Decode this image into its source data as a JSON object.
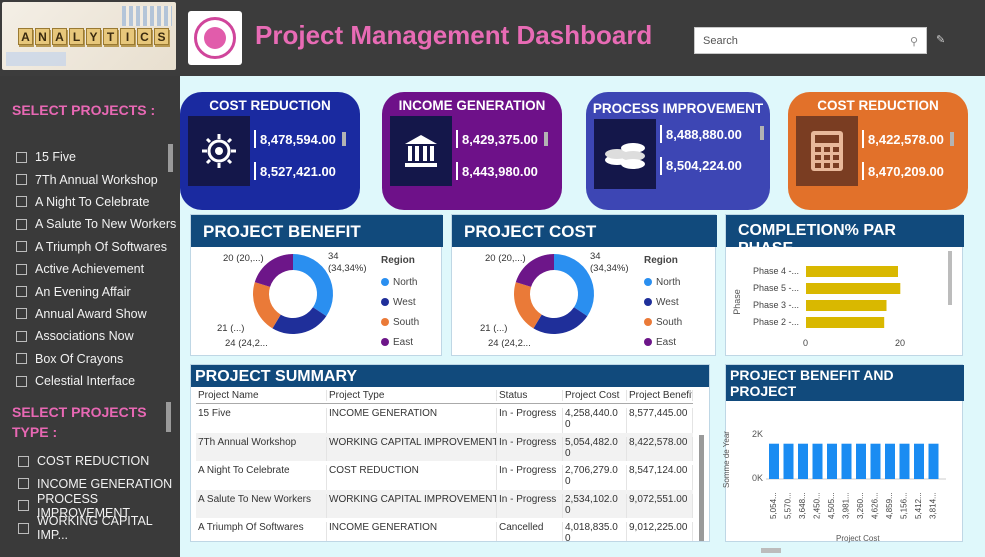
{
  "header": {
    "logo_text": "ANALYTICS",
    "title": "Project Management Dashboard",
    "search_placeholder": "Search"
  },
  "sidebar": {
    "projects_title": "SELECT PROJECTS :",
    "projects": [
      "15 Five",
      "7Th Annual Workshop",
      "A Night To Celebrate",
      "A Salute To New Workers",
      "A Triumph Of Softwares",
      "Active Achievement",
      "An Evening Affair",
      "Annual Award Show",
      "Associations Now",
      "Box Of Crayons",
      "Celestial Interface"
    ],
    "types_title_1": "SELECT PROJECTS",
    "types_title_2": "TYPE :",
    "types": [
      "COST REDUCTION",
      "INCOME GENERATION",
      "PROCESS IMPROVEMENT",
      "WORKING CAPITAL IMP..."
    ]
  },
  "kpis": [
    {
      "title": "COST REDUCTION",
      "icon": "lightbulb-gear-icon",
      "v1": "8,478,594.00",
      "v2": "8,527,421.00",
      "color": "#1a2aa0"
    },
    {
      "title": "INCOME GENERATION",
      "icon": "bank-icon",
      "v1": "8,429,375.00",
      "v2": "8,443,980.00",
      "color": "#6e1189"
    },
    {
      "title": "PROCESS IMPROVEMENT",
      "icon": "coins-icon",
      "v1": "8,488,880.00",
      "v2": "8,504,224.00",
      "color": "#3d46b4"
    },
    {
      "title": "COST REDUCTION",
      "icon": "calculator-icon",
      "v1": "8,422,578.00",
      "v2": "8,470,209.00",
      "color": "#e2712a"
    }
  ],
  "benefit": {
    "title": "PROJECT BENEFIT",
    "labels": {
      "top_left": "20 (20,...)",
      "top_right_1": "34",
      "top_right_2": "(34,34%)",
      "mid_left": "21 (...)",
      "bottom_left": "24 (24,2..."
    }
  },
  "cost": {
    "title": "PROJECT COST",
    "labels": {
      "top_left": "20 (20,...)",
      "top_right_1": "34",
      "top_right_2": "(34,34%)",
      "mid_left": "21 (...)",
      "bottom_left": "24 (24,2..."
    }
  },
  "legend": {
    "title": "Region",
    "items": [
      {
        "name": "North",
        "color": "#2a8ff0"
      },
      {
        "name": "West",
        "color": "#1f2f9a"
      },
      {
        "name": "South",
        "color": "#ea7a38"
      },
      {
        "name": "East",
        "color": "#6d1689"
      }
    ]
  },
  "completion": {
    "title": "COMPLETION% PAR PHASE",
    "ylabel": "Phase",
    "phases": [
      {
        "label": "Phase 4 -...",
        "value": 20
      },
      {
        "label": "Phase 5 -...",
        "value": 20.5
      },
      {
        "label": "Phase 3 -...",
        "value": 17.5
      },
      {
        "label": "Phase 2 -...",
        "value": 17
      }
    ],
    "ticks": [
      "0",
      "20"
    ]
  },
  "summary": {
    "title": "PROJECT SUMMARY",
    "headers": [
      "Project Name",
      "Project Type",
      "Status",
      "Project Cost",
      "Project Benefit"
    ],
    "rows": [
      [
        "15 Five",
        "INCOME GENERATION",
        "In - Progress",
        "4,258,440.0",
        "8,577,445.00"
      ],
      [
        "7Th Annual Workshop",
        "WORKING CAPITAL IMPROVEMENT",
        "In - Progress",
        "5,054,482.0",
        "8,422,578.00"
      ],
      [
        "A Night To Celebrate",
        "COST REDUCTION",
        "In - Progress",
        "2,706,279.0",
        "8,547,124.00"
      ],
      [
        "A Salute To New Workers",
        "WORKING CAPITAL IMPROVEMENT",
        "In - Progress",
        "2,534,102.0",
        "9,072,551.00"
      ],
      [
        "A Triumph Of Softwares",
        "INCOME GENERATION",
        "Cancelled",
        "4,018,835.0",
        "9,012,225.00"
      ]
    ],
    "cont": "0"
  },
  "benefit_cost": {
    "title_1": "PROJECT BENEFIT AND PROJECT",
    "title_2": "COST",
    "ylabel": "Somme de Year",
    "xlabel": "Project Cost",
    "yticks": [
      "2K",
      "0K"
    ],
    "x_labels": [
      "5,054...",
      "5,570...",
      "3,648...",
      "2,450...",
      "4,505...",
      "3,981...",
      "3,260...",
      "4,626...",
      "4,859...",
      "5,156...",
      "5,412...",
      "3,814..."
    ]
  },
  "chart_data": [
    {
      "type": "pie",
      "title": "PROJECT BENEFIT",
      "categories": [
        "North",
        "West",
        "South",
        "East"
      ],
      "values": [
        34,
        24,
        21,
        20
      ],
      "legend_title": "Region"
    },
    {
      "type": "pie",
      "title": "PROJECT COST",
      "categories": [
        "North",
        "West",
        "South",
        "East"
      ],
      "values": [
        34,
        24,
        21,
        20
      ],
      "legend_title": "Region"
    },
    {
      "type": "bar",
      "title": "COMPLETION% PAR PHASE",
      "categories": [
        "Phase 4 -...",
        "Phase 5 -...",
        "Phase 3 -...",
        "Phase 2 -..."
      ],
      "values": [
        20,
        20.5,
        17.5,
        17
      ],
      "ylabel": "Phase",
      "xlim": [
        0,
        25
      ]
    },
    {
      "type": "bar",
      "title": "PROJECT BENEFIT AND PROJECT COST",
      "categories": [
        "5,054...",
        "5,570...",
        "3,648...",
        "2,450...",
        "4,505...",
        "3,981...",
        "3,260...",
        "4,626...",
        "4,859...",
        "5,156...",
        "5,412...",
        "3,814..."
      ],
      "values": [
        2020,
        2020,
        2020,
        2020,
        2020,
        2020,
        2020,
        2020,
        2020,
        2020,
        2020,
        2020
      ],
      "xlabel": "Project Cost",
      "ylabel": "Somme de Year",
      "ylim": [
        0,
        2500
      ]
    }
  ]
}
